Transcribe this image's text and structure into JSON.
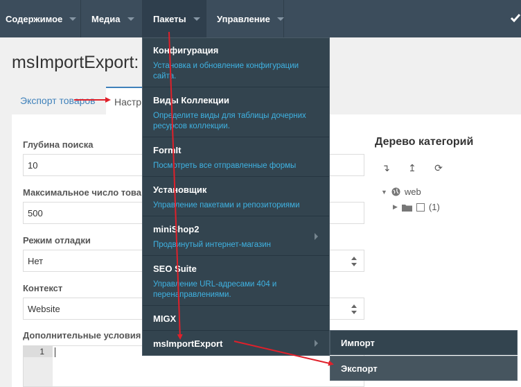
{
  "nav": {
    "items": [
      {
        "label": "Содержимое"
      },
      {
        "label": "Медиа"
      },
      {
        "label": "Пакеты"
      },
      {
        "label": "Управление"
      }
    ]
  },
  "page": {
    "title": "msImportExport:",
    "tabs": [
      "Экспорт товаров",
      "Настр"
    ]
  },
  "form": {
    "depth_label": "Глубина поиска",
    "depth_value": "10",
    "max_label": "Максимальное число това",
    "max_value": "500",
    "debug_label": "Режим отладки",
    "debug_value": "Нет",
    "context_label": "Контекст",
    "context_value": "Website",
    "extra_label": "Дополнительные условия",
    "editor_line": "1"
  },
  "tree": {
    "title": "Дерево категорий",
    "root": "web",
    "child": "(1)"
  },
  "dropdown": {
    "items": [
      {
        "title": "Конфигурация",
        "desc": "Установка и обновление конфигурации сайта."
      },
      {
        "title": "Виды Коллекции",
        "desc": "Определите виды для таблицы дочерних ресурсов коллекции."
      },
      {
        "title": "FormIt",
        "desc": "Посмотреть все отправленные формы"
      },
      {
        "title": "Установщик",
        "desc": "Управление пакетами и репозиториями"
      },
      {
        "title": "miniShop2",
        "desc": "Продвинутый интернет-магазин"
      },
      {
        "title": "SEO Suite",
        "desc": "Управление URL-адресами 404 и перенаправлениями."
      },
      {
        "title": "MIGX",
        "desc": ""
      },
      {
        "title": "msImportExport",
        "desc": ""
      }
    ]
  },
  "submenu": {
    "import": "Импорт",
    "export": "Экспорт"
  },
  "colors": {
    "topbar": "#3c4d5c",
    "dropdown": "#33444f",
    "desc": "#3fb3e3",
    "annotation_arrow": "#e0202a"
  }
}
